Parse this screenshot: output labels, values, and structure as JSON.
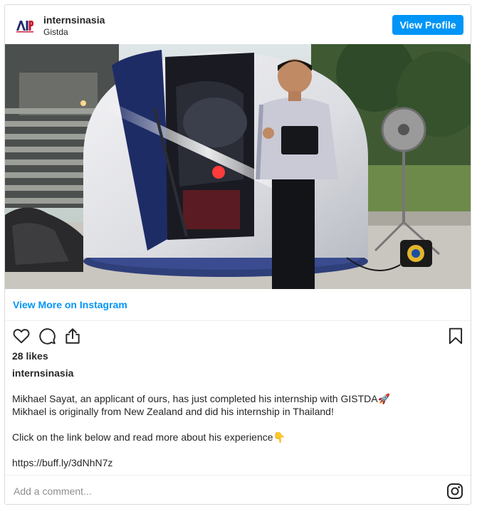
{
  "header": {
    "account_name": "internsinasia",
    "subtitle": "Gistda",
    "logo_icon": "aia-logo",
    "view_profile_label": "View Profile",
    "accent_color": "#0095f6"
  },
  "post": {
    "view_more_label": "View More on Instagram",
    "likes": "28 likes",
    "caption_user": "internsinasia",
    "caption_lines": [
      "Mikhael Sayat, an applicant of ours, has just completed his internship with GISTDA🚀",
      "Mikhael is originally from New Zealand and did his internship in Thailand!",
      "",
      "Click on the link below and read more about his experience👇",
      "",
      "https://buff.ly/3dNhN7z"
    ],
    "action_icons": [
      "heart-icon",
      "comment-icon",
      "share-icon",
      "bookmark-icon"
    ]
  },
  "comment": {
    "placeholder": "Add a comment...",
    "icon": "instagram-icon"
  }
}
